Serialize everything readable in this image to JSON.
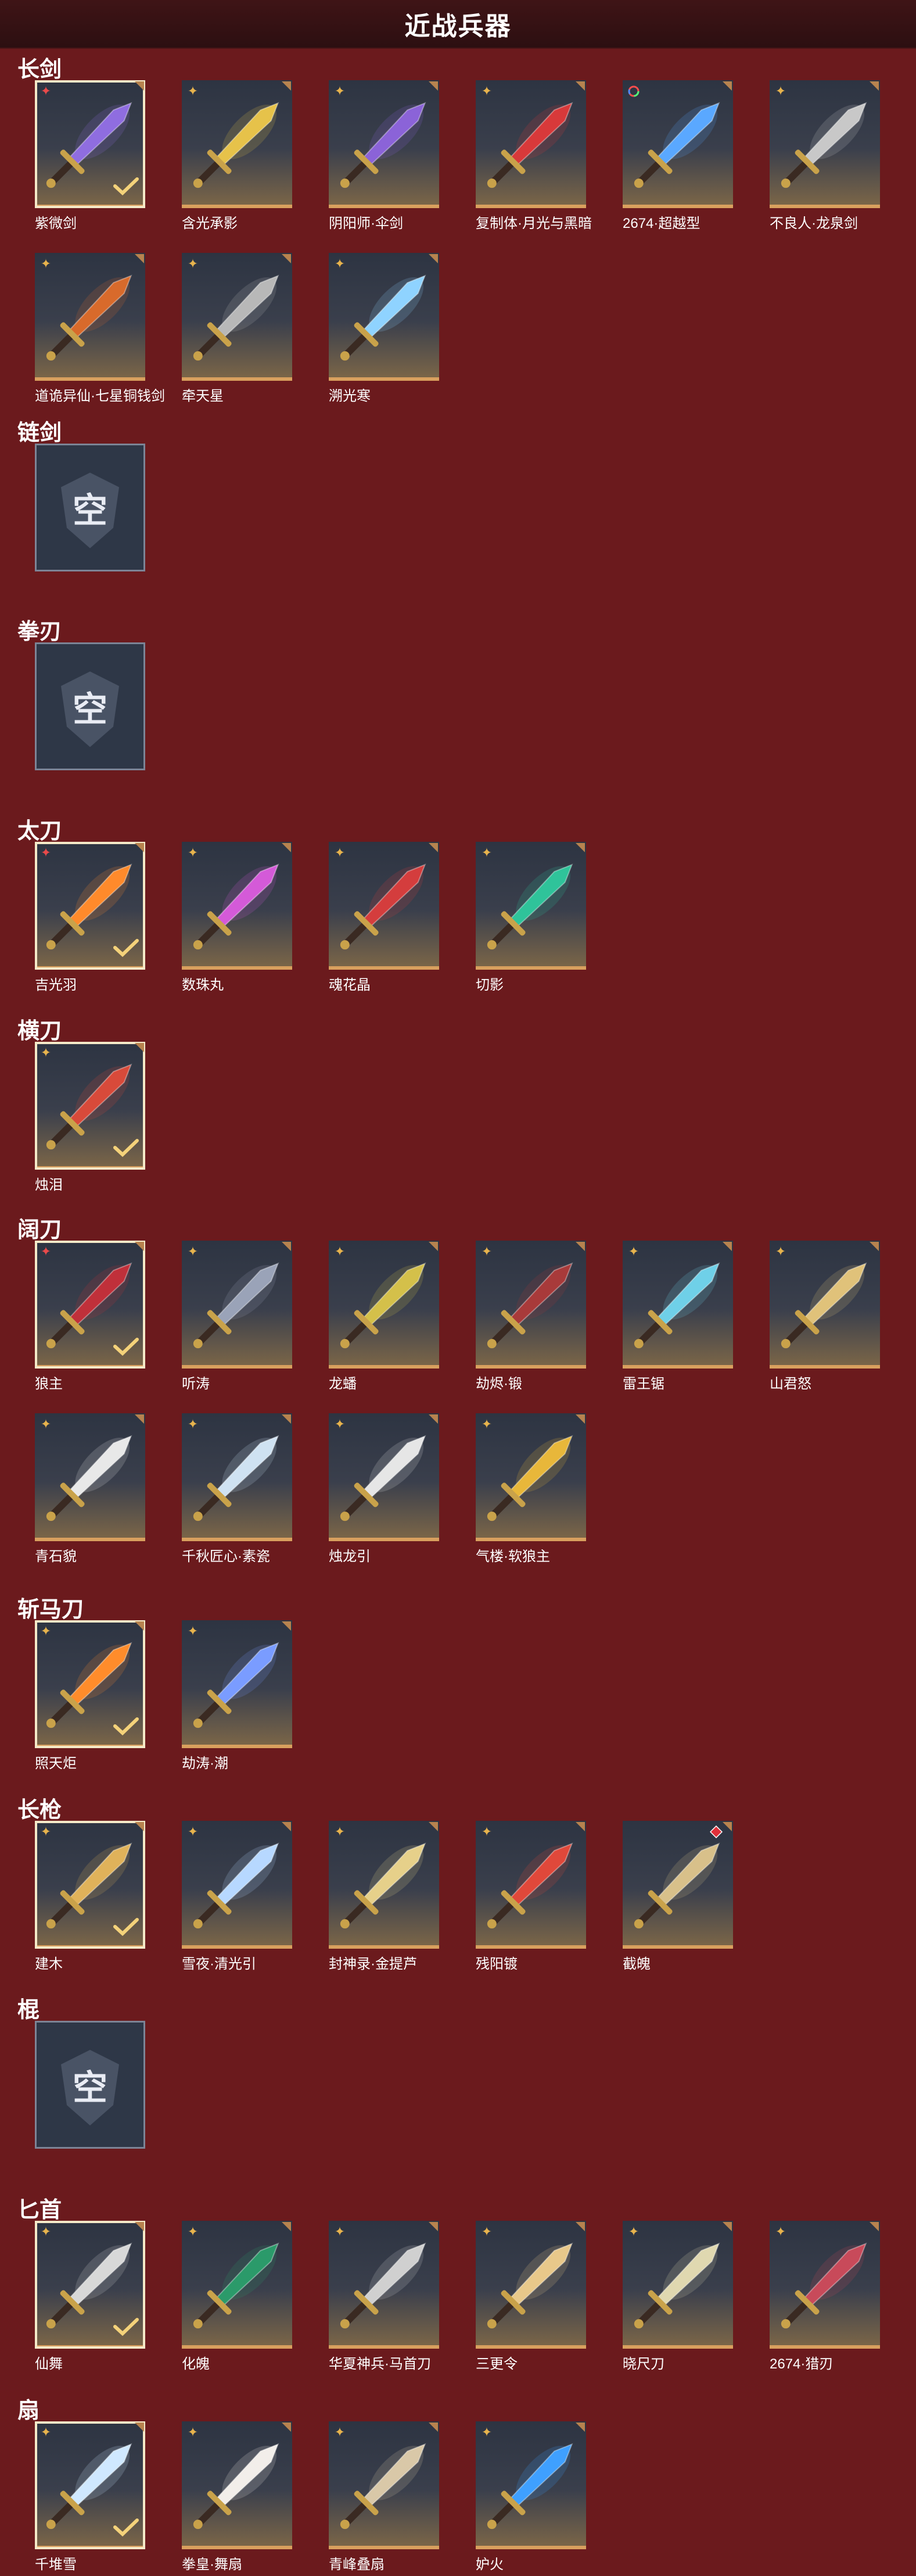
{
  "header": {
    "title": "近战兵器"
  },
  "sections": [
    {
      "title": "长剑",
      "items": [
        {
          "label": "紫微剑",
          "star": "red",
          "selected": true,
          "color": "#8f6de0"
        },
        {
          "label": "含光承影",
          "star": "gold",
          "selected": false,
          "color": "#e6c24a"
        },
        {
          "label": "阴阳师·伞剑",
          "star": "gold",
          "selected": false,
          "color": "#8b63d8"
        },
        {
          "label": "复制体·月光与黑暗",
          "star": "gold",
          "selected": false,
          "color": "#d8393a"
        },
        {
          "label": "2674·超越型",
          "star": "rainbow",
          "selected": false,
          "color": "#5aa8ff"
        },
        {
          "label": "不良人·龙泉剑",
          "star": "gold",
          "selected": false,
          "color": "#c8c8c8"
        },
        {
          "label": "道诡异仙·七星铜钱剑",
          "star": "gold",
          "selected": false,
          "color": "#d86a2b"
        },
        {
          "label": "牵天星",
          "star": "gold",
          "selected": false,
          "color": "#b8b8b8"
        },
        {
          "label": "溯光寒",
          "star": "gold",
          "selected": false,
          "color": "#8fd3ff"
        }
      ]
    },
    {
      "title": "链剑",
      "empty_label": "空"
    },
    {
      "title": "拳刃",
      "empty_label": "空"
    },
    {
      "title": "太刀",
      "items": [
        {
          "label": "吉光羽",
          "star": "red",
          "selected": true,
          "color": "#ff8a2b"
        },
        {
          "label": "数珠丸",
          "star": "gold",
          "selected": false,
          "color": "#d45ad8"
        },
        {
          "label": "魂花晶",
          "star": "gold",
          "selected": false,
          "color": "#d43d3d"
        },
        {
          "label": "切影",
          "star": "gold",
          "selected": false,
          "color": "#2fc39a"
        }
      ]
    },
    {
      "title": "横刀",
      "items": [
        {
          "label": "烛泪",
          "star": "gold",
          "selected": true,
          "color": "#d84a3a"
        }
      ]
    },
    {
      "title": "阔刀",
      "items": [
        {
          "label": "狼主",
          "star": "red",
          "selected": true,
          "color": "#c0303a"
        },
        {
          "label": "听涛",
          "star": "gold",
          "selected": false,
          "color": "#9aa3b8"
        },
        {
          "label": "龙蟠",
          "star": "gold",
          "selected": false,
          "color": "#d4c04a"
        },
        {
          "label": "劫烬·锻",
          "star": "gold",
          "selected": false,
          "color": "#a83a3a"
        },
        {
          "label": "雷王锯",
          "star": "gold",
          "selected": false,
          "color": "#6fd0e8"
        },
        {
          "label": "山君怒",
          "star": "gold",
          "selected": false,
          "color": "#e0c27a"
        },
        {
          "label": "青石貌",
          "star": "gold",
          "selected": false,
          "color": "#e8e8e8"
        },
        {
          "label": "千秋匠心·素瓷",
          "star": "gold",
          "selected": false,
          "color": "#cfe2f2"
        },
        {
          "label": "烛龙引",
          "star": "gold",
          "selected": false,
          "color": "#e6e6e6"
        },
        {
          "label": "气楼·软狼主",
          "star": "gold",
          "selected": false,
          "color": "#e8b73a"
        }
      ]
    },
    {
      "title": "斩马刀",
      "items": [
        {
          "label": "照天炬",
          "star": "gold",
          "selected": true,
          "color": "#ff8c2b"
        },
        {
          "label": "劫涛·潮",
          "star": "gold",
          "selected": false,
          "color": "#7a9cff"
        }
      ]
    },
    {
      "title": "长枪",
      "items": [
        {
          "label": "建木",
          "star": "gold",
          "selected": true,
          "color": "#e0b25a"
        },
        {
          "label": "雪夜·清光引",
          "star": "gold",
          "selected": false,
          "color": "#b7d8ff"
        },
        {
          "label": "封神录·金提芦",
          "star": "gold",
          "selected": false,
          "color": "#e6d08a"
        },
        {
          "label": "残阳镀",
          "star": "gold",
          "selected": false,
          "color": "#e0483a"
        },
        {
          "label": "截魄",
          "star": "redgem",
          "selected": false,
          "color": "#d8c08a"
        }
      ]
    },
    {
      "title": "棍",
      "empty_label": "空"
    },
    {
      "title": "匕首",
      "items": [
        {
          "label": "仙舞",
          "star": "gold",
          "selected": true,
          "color": "#d8d8d8"
        },
        {
          "label": "化魄",
          "star": "gold",
          "selected": false,
          "color": "#2b9a6a"
        },
        {
          "label": "华夏神兵·马首刀",
          "star": "gold",
          "selected": false,
          "color": "#d0d0d0"
        },
        {
          "label": "三更令",
          "star": "gold",
          "selected": false,
          "color": "#e8c88a"
        },
        {
          "label": "晓尺刀",
          "star": "gold",
          "selected": false,
          "color": "#e0d8b0"
        },
        {
          "label": "2674·猎刃",
          "star": "gold",
          "selected": false,
          "color": "#c84a5a"
        }
      ]
    },
    {
      "title": "扇",
      "items": [
        {
          "label": "千堆雪",
          "star": "gold",
          "selected": true,
          "color": "#cfe8ff"
        },
        {
          "label": "拳皇·舞扇",
          "star": "gold",
          "selected": false,
          "color": "#f2eeea"
        },
        {
          "label": "青峰叠扇",
          "star": "gold",
          "selected": false,
          "color": "#d9c8a8"
        },
        {
          "label": "妒火",
          "star": "gold",
          "selected": false,
          "color": "#3fa0ff"
        }
      ]
    }
  ]
}
